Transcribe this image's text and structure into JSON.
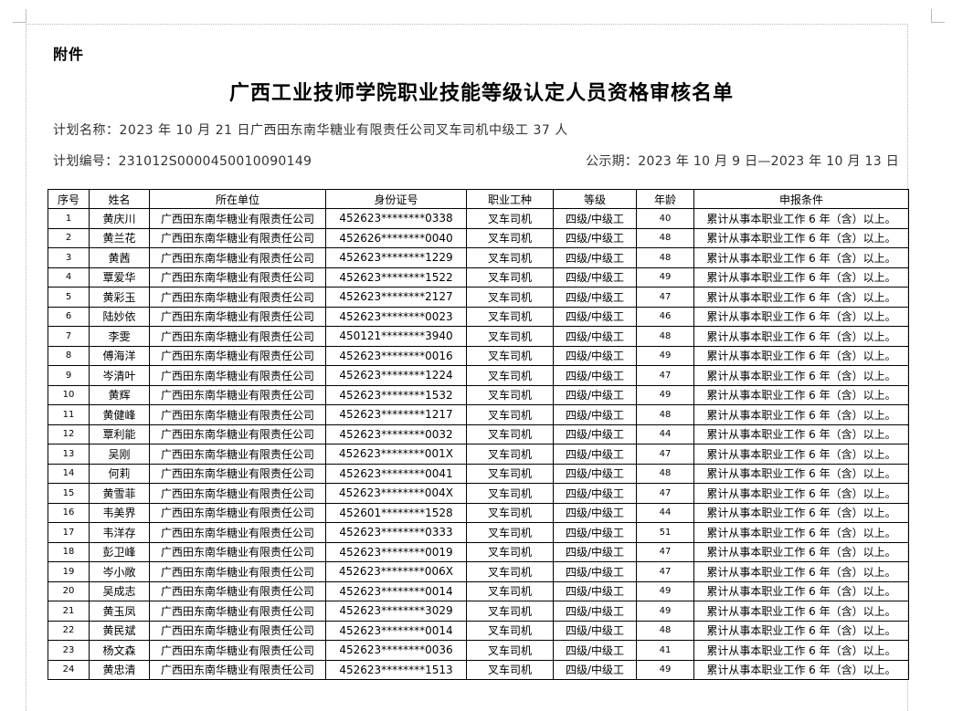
{
  "document": {
    "attachment_label": "附件",
    "title": "广西工业技师学院职业技能等级认定人员资格审核名单",
    "plan_name": "计划名称：2023 年 10 月 21 日广西田东南华糖业有限责任公司叉车司机中级工 37 人",
    "plan_number": "计划编号：231012S0000450010090149",
    "publicity_period": "公示期：2023 年 10 月 9 日—2023 年 10 月 13 日"
  },
  "table": {
    "headers": [
      "序号",
      "姓名",
      "所在单位",
      "身份证号",
      "职业工种",
      "等级",
      "年龄",
      "申报条件"
    ],
    "rows": [
      [
        "1",
        "黄庆川",
        "广西田东南华糖业有限责任公司",
        "452623********0338",
        "叉车司机",
        "四级/中级工",
        "40",
        "累计从事本职业工作 6 年（含）以上。"
      ],
      [
        "2",
        "黄兰花",
        "广西田东南华糖业有限责任公司",
        "452626********0040",
        "叉车司机",
        "四级/中级工",
        "48",
        "累计从事本职业工作 6 年（含）以上。"
      ],
      [
        "3",
        "黄茜",
        "广西田东南华糖业有限责任公司",
        "452623********1229",
        "叉车司机",
        "四级/中级工",
        "48",
        "累计从事本职业工作 6 年（含）以上。"
      ],
      [
        "4",
        "覃爱华",
        "广西田东南华糖业有限责任公司",
        "452623********1522",
        "叉车司机",
        "四级/中级工",
        "49",
        "累计从事本职业工作 6 年（含）以上。"
      ],
      [
        "5",
        "黄彩玉",
        "广西田东南华糖业有限责任公司",
        "452623********2127",
        "叉车司机",
        "四级/中级工",
        "47",
        "累计从事本职业工作 6 年（含）以上。"
      ],
      [
        "6",
        "陆妙依",
        "广西田东南华糖业有限责任公司",
        "452623********0023",
        "叉车司机",
        "四级/中级工",
        "46",
        "累计从事本职业工作 6 年（含）以上。"
      ],
      [
        "7",
        "李雯",
        "广西田东南华糖业有限责任公司",
        "450121********3940",
        "叉车司机",
        "四级/中级工",
        "48",
        "累计从事本职业工作 6 年（含）以上。"
      ],
      [
        "8",
        "傅海洋",
        "广西田东南华糖业有限责任公司",
        "452623********0016",
        "叉车司机",
        "四级/中级工",
        "49",
        "累计从事本职业工作 6 年（含）以上。"
      ],
      [
        "9",
        "岑清叶",
        "广西田东南华糖业有限责任公司",
        "452623********1224",
        "叉车司机",
        "四级/中级工",
        "47",
        "累计从事本职业工作 6 年（含）以上。"
      ],
      [
        "10",
        "黄辉",
        "广西田东南华糖业有限责任公司",
        "452623********1532",
        "叉车司机",
        "四级/中级工",
        "49",
        "累计从事本职业工作 6 年（含）以上。"
      ],
      [
        "11",
        "黄健峰",
        "广西田东南华糖业有限责任公司",
        "452623********1217",
        "叉车司机",
        "四级/中级工",
        "48",
        "累计从事本职业工作 6 年（含）以上。"
      ],
      [
        "12",
        "覃利能",
        "广西田东南华糖业有限责任公司",
        "452623********0032",
        "叉车司机",
        "四级/中级工",
        "44",
        "累计从事本职业工作 6 年（含）以上。"
      ],
      [
        "13",
        "吴刚",
        "广西田东南华糖业有限责任公司",
        "452623********001X",
        "叉车司机",
        "四级/中级工",
        "47",
        "累计从事本职业工作 6 年（含）以上。"
      ],
      [
        "14",
        "何莉",
        "广西田东南华糖业有限责任公司",
        "452623********0041",
        "叉车司机",
        "四级/中级工",
        "48",
        "累计从事本职业工作 6 年（含）以上。"
      ],
      [
        "15",
        "黄雪菲",
        "广西田东南华糖业有限责任公司",
        "452623********004X",
        "叉车司机",
        "四级/中级工",
        "47",
        "累计从事本职业工作 6 年（含）以上。"
      ],
      [
        "16",
        "韦美界",
        "广西田东南华糖业有限责任公司",
        "452601********1528",
        "叉车司机",
        "四级/中级工",
        "44",
        "累计从事本职业工作 6 年（含）以上。"
      ],
      [
        "17",
        "韦洋存",
        "广西田东南华糖业有限责任公司",
        "452623********0333",
        "叉车司机",
        "四级/中级工",
        "51",
        "累计从事本职业工作 6 年（含）以上。"
      ],
      [
        "18",
        "彭卫峰",
        "广西田东南华糖业有限责任公司",
        "452623********0019",
        "叉车司机",
        "四级/中级工",
        "47",
        "累计从事本职业工作 6 年（含）以上。"
      ],
      [
        "19",
        "岑小敞",
        "广西田东南华糖业有限责任公司",
        "452623********006X",
        "叉车司机",
        "四级/中级工",
        "47",
        "累计从事本职业工作 6 年（含）以上。"
      ],
      [
        "20",
        "吴成志",
        "广西田东南华糖业有限责任公司",
        "452623********0014",
        "叉车司机",
        "四级/中级工",
        "49",
        "累计从事本职业工作 6 年（含）以上。"
      ],
      [
        "21",
        "黄玉凤",
        "广西田东南华糖业有限责任公司",
        "452623********3029",
        "叉车司机",
        "四级/中级工",
        "49",
        "累计从事本职业工作 6 年（含）以上。"
      ],
      [
        "22",
        "黄民斌",
        "广西田东南华糖业有限责任公司",
        "452623********0014",
        "叉车司机",
        "四级/中级工",
        "48",
        "累计从事本职业工作 6 年（含）以上。"
      ],
      [
        "23",
        "杨文森",
        "广西田东南华糖业有限责任公司",
        "452623********0036",
        "叉车司机",
        "四级/中级工",
        "41",
        "累计从事本职业工作 6 年（含）以上。"
      ],
      [
        "24",
        "黄忠清",
        "广西田东南华糖业有限责任公司",
        "452623********1513",
        "叉车司机",
        "四级/中级工",
        "49",
        "累计从事本职业工作 6 年（含）以上。"
      ]
    ]
  }
}
